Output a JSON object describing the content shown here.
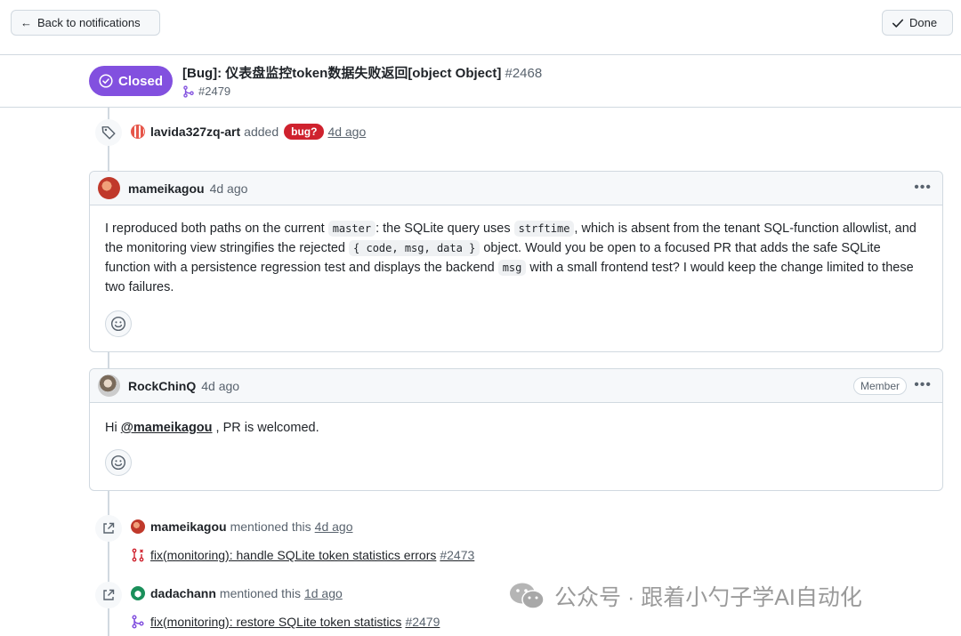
{
  "topbar": {
    "back_label": "Back to notifications",
    "done_label": "Done"
  },
  "issue": {
    "state": "Closed",
    "title": "[Bug]: 仪表盘监控token数据失败返回[object Object]",
    "number": "#2468",
    "linked_pr": "#2479"
  },
  "label_event": {
    "user": "lavida327zq-art",
    "action": "added",
    "label": "bug?",
    "time": "4d ago"
  },
  "comments": [
    {
      "user": "mameikagou",
      "time": "4d ago",
      "body": {
        "t1": "I reproduced both paths on the current ",
        "c1": "master",
        "t2": ": the SQLite query uses ",
        "c2": "strftime",
        "t3": ", which is absent from the tenant SQL-function allowlist, and the monitoring view stringifies the rejected ",
        "c3": "{ code, msg, data }",
        "t4": " object. Would you be open to a focused PR that adds the safe SQLite function with a persistence regression test and displays the backend ",
        "c4": "msg",
        "t5": " with a small frontend test? I would keep the change limited to these two failures."
      }
    },
    {
      "user": "RockChinQ",
      "time": "4d ago",
      "badge": "Member",
      "body": {
        "t1": "Hi ",
        "mention": "@mameikagou",
        "t2": " , PR is welcomed."
      }
    }
  ],
  "mentions": [
    {
      "user": "mameikagou",
      "action": "mentioned this",
      "time": "4d ago",
      "ref_title": "fix(monitoring): handle SQLite token statistics errors",
      "ref_number": "#2473",
      "ref_color": "#cf222e"
    },
    {
      "user": "dadachann",
      "action": "mentioned this",
      "time": "1d ago",
      "ref_title": "fix(monitoring): restore SQLite token statistics",
      "ref_number": "#2479",
      "ref_color": "#8250df"
    }
  ],
  "watermark": "公众号 · 跟着小勺子学AI自动化",
  "colors": {
    "closed": "#8250df",
    "bug_label": "#cf222e",
    "border": "#d1d9e0"
  }
}
